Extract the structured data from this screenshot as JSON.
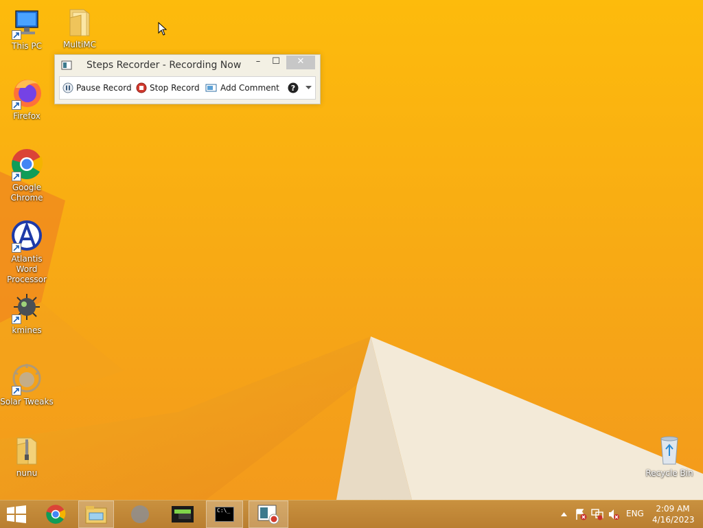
{
  "desktop": {
    "icons": [
      {
        "label": "This PC",
        "icon": "computer-icon"
      },
      {
        "label": "MultiMC",
        "icon": "folder-icon"
      },
      {
        "label": "Firefox",
        "icon": "firefox-icon"
      },
      {
        "label": "Google Chrome",
        "icon": "chrome-icon"
      },
      {
        "label": "Atlantis Word Processor",
        "icon": "atlantis-icon"
      },
      {
        "label": "kmines",
        "icon": "kmines-icon"
      },
      {
        "label": "Solar Tweaks",
        "icon": "solar-tweaks-icon"
      },
      {
        "label": "nunu",
        "icon": "zip-folder-icon"
      },
      {
        "label": "Recycle Bin",
        "icon": "recycle-bin-icon"
      }
    ]
  },
  "steps_recorder": {
    "title": "Steps Recorder - Recording Now",
    "pause_label": "Pause Record",
    "stop_label": "Stop Record",
    "comment_label": "Add Comment",
    "window_buttons": {
      "minimize": "–",
      "maximize": "☐",
      "close": "✕"
    }
  },
  "taskbar": {
    "items": [
      {
        "name": "start",
        "icon": "windows-logo-icon"
      },
      {
        "name": "chrome",
        "icon": "chrome-icon"
      },
      {
        "name": "file-explorer",
        "icon": "file-explorer-icon"
      },
      {
        "name": "app-gray",
        "icon": "gray-app-icon"
      },
      {
        "name": "app-green",
        "icon": "green-app-icon"
      },
      {
        "name": "command-prompt",
        "icon": "cmd-icon",
        "label": "C:\\_"
      },
      {
        "name": "steps-recorder",
        "icon": "steps-recorder-icon"
      }
    ],
    "tray": {
      "language": "ENG",
      "time": "2:09 AM",
      "date": "4/16/2023"
    }
  },
  "colors": {
    "wallpaper_orange": "#f6ae10",
    "wallpaper_cream": "#f1e8d9",
    "taskbar": "#c48a3a"
  }
}
